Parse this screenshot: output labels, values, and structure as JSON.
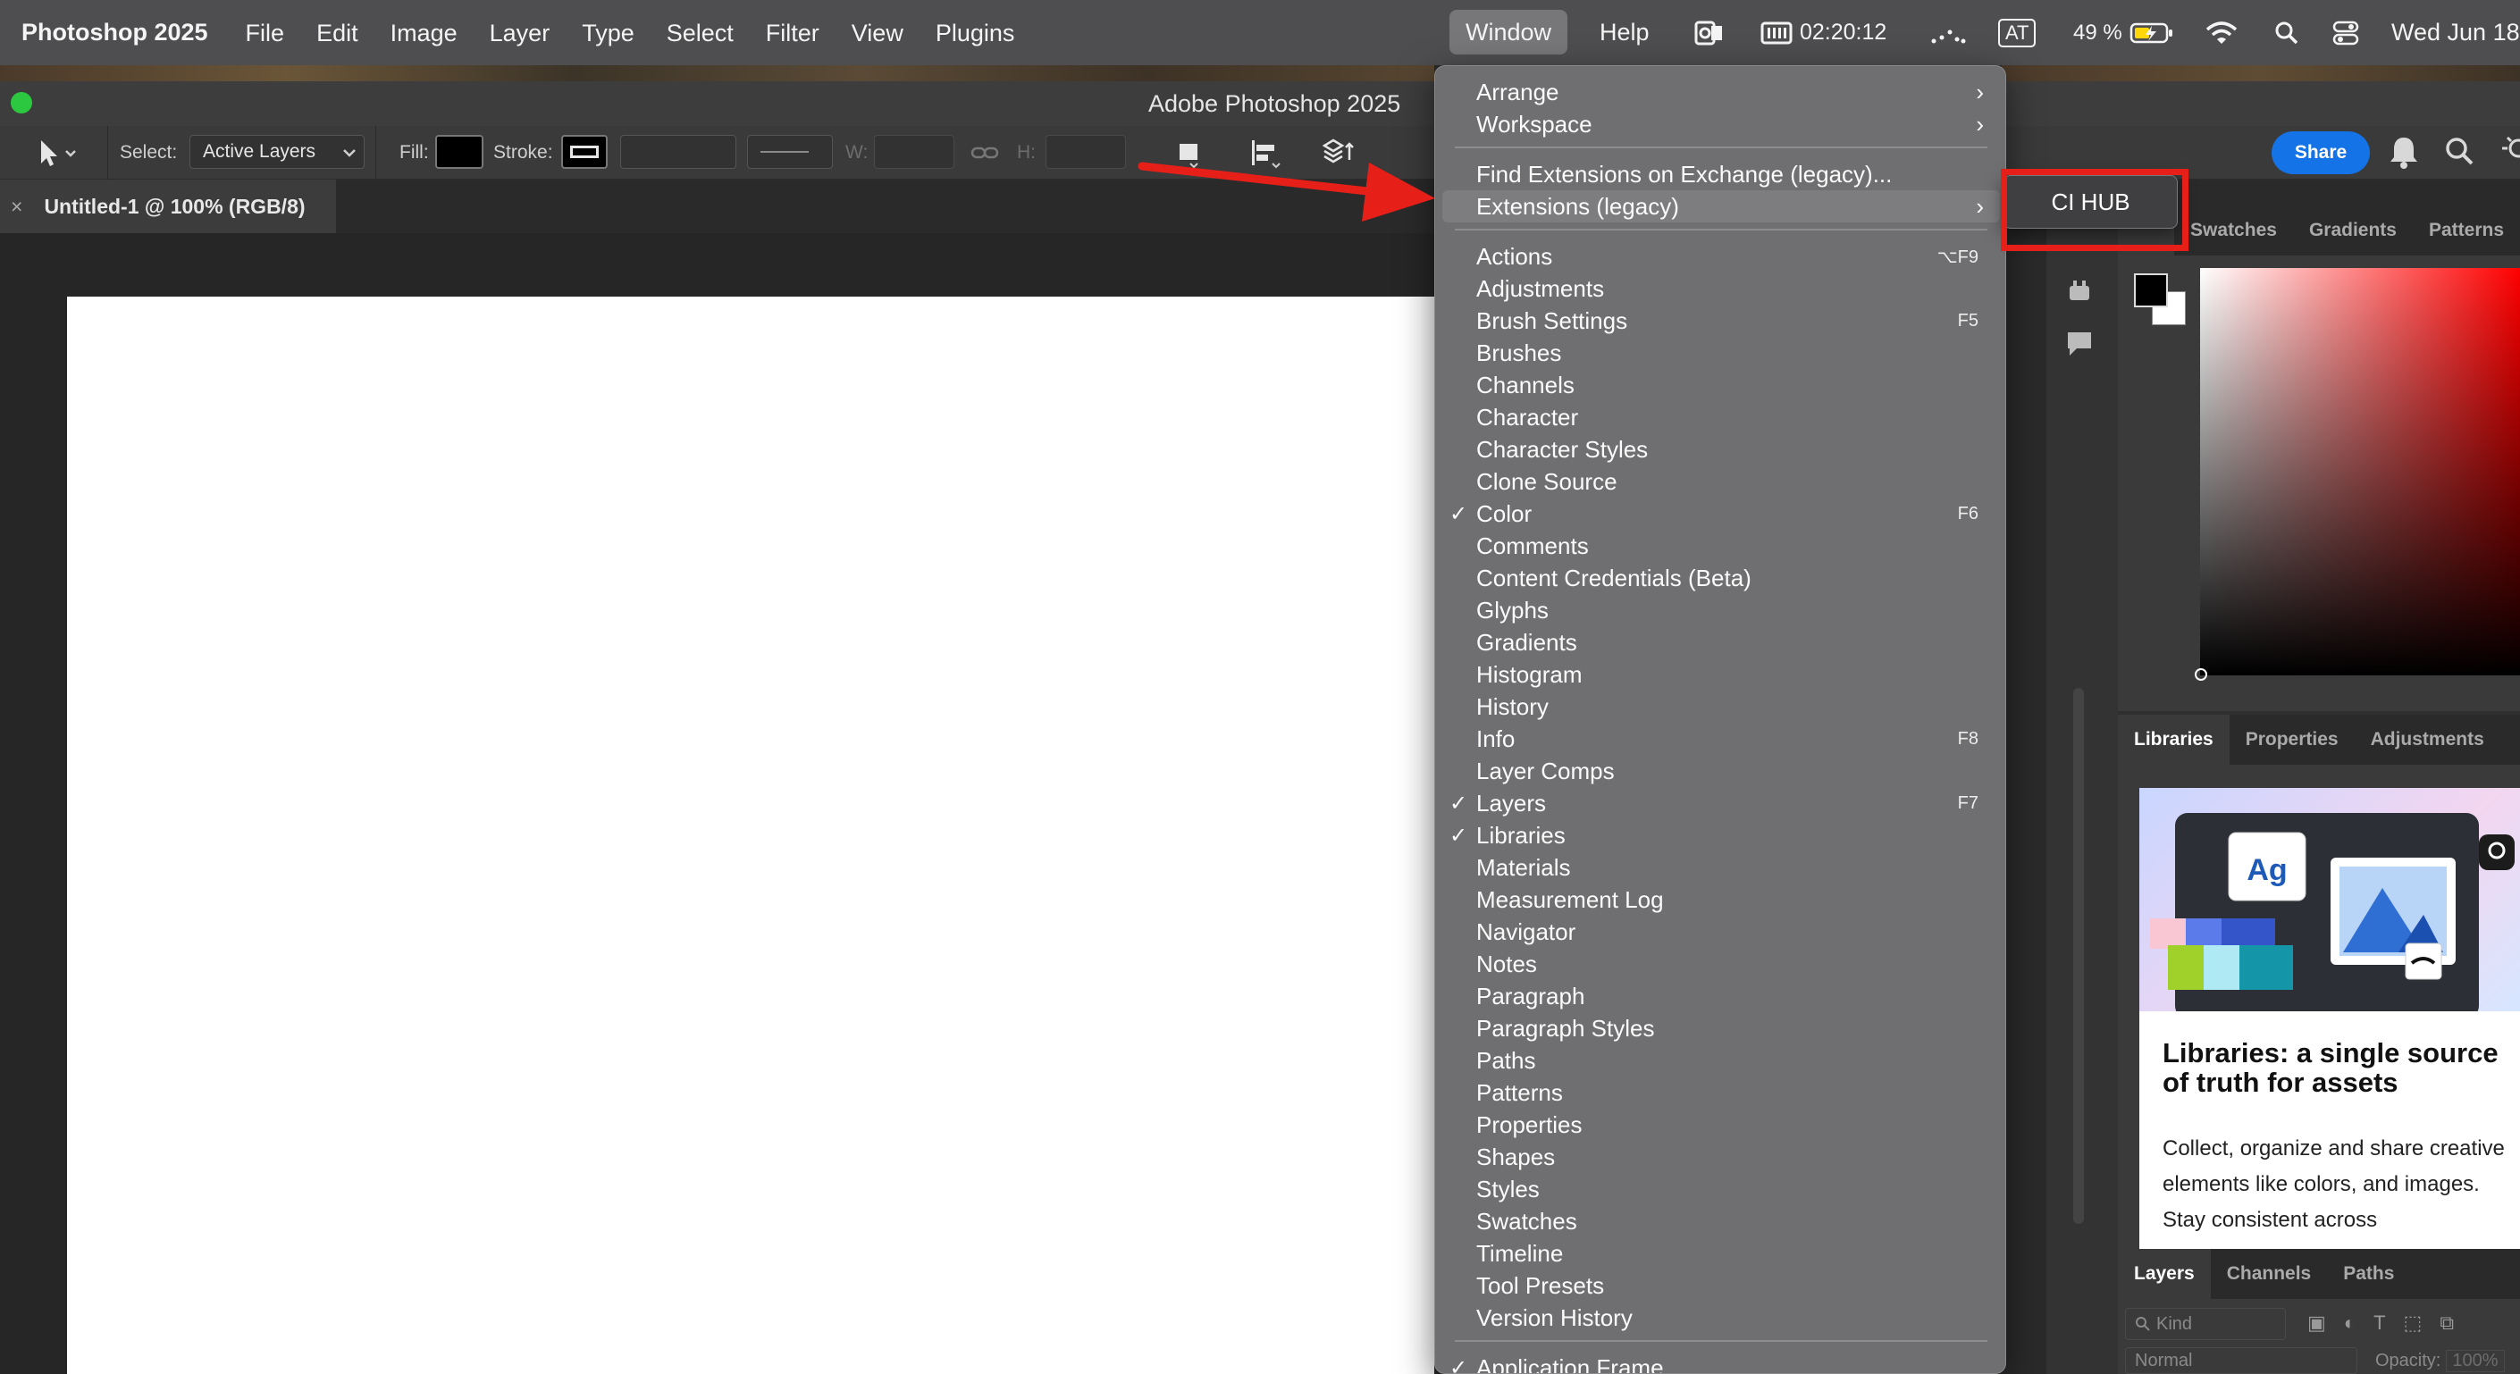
{
  "menubar": {
    "app_name": "Photoshop 2025",
    "items": [
      "File",
      "Edit",
      "Image",
      "Layer",
      "Type",
      "Select",
      "Filter",
      "View",
      "Plugins"
    ],
    "window": "Window",
    "help": "Help",
    "clock": "02:20:12",
    "input_source": "AT",
    "battery": "49 %",
    "date": "Wed Jun 18"
  },
  "window_title": "Adobe Photoshop 2025",
  "options": {
    "select_label": "Select:",
    "select_value": "Active Layers",
    "fill_label": "Fill:",
    "stroke_label": "Stroke:",
    "w_label": "W:",
    "h_label": "H:",
    "share": "Share"
  },
  "document": {
    "tab_title": "Untitled-1 @ 100% (RGB/8)",
    "close": "×"
  },
  "window_menu": {
    "top": [
      {
        "label": "Arrange",
        "submenu": true
      },
      {
        "label": "Workspace",
        "submenu": true
      }
    ],
    "extensions": [
      {
        "label": "Find Extensions on Exchange (legacy)...",
        "submenu": false
      },
      {
        "label": "Extensions (legacy)",
        "submenu": true,
        "highlighted": true
      }
    ],
    "panels": [
      {
        "label": "Actions",
        "shortcut": "⌥F9"
      },
      {
        "label": "Adjustments"
      },
      {
        "label": "Brush Settings",
        "shortcut": "F5"
      },
      {
        "label": "Brushes"
      },
      {
        "label": "Channels"
      },
      {
        "label": "Character"
      },
      {
        "label": "Character Styles"
      },
      {
        "label": "Clone Source"
      },
      {
        "label": "Color",
        "shortcut": "F6",
        "checked": true
      },
      {
        "label": "Comments"
      },
      {
        "label": "Content Credentials (Beta)"
      },
      {
        "label": "Glyphs"
      },
      {
        "label": "Gradients"
      },
      {
        "label": "Histogram"
      },
      {
        "label": "History"
      },
      {
        "label": "Info",
        "shortcut": "F8"
      },
      {
        "label": "Layer Comps"
      },
      {
        "label": "Layers",
        "shortcut": "F7",
        "checked": true
      },
      {
        "label": "Libraries",
        "checked": true
      },
      {
        "label": "Materials"
      },
      {
        "label": "Measurement Log"
      },
      {
        "label": "Navigator"
      },
      {
        "label": "Notes"
      },
      {
        "label": "Paragraph"
      },
      {
        "label": "Paragraph Styles"
      },
      {
        "label": "Paths"
      },
      {
        "label": "Patterns"
      },
      {
        "label": "Properties"
      },
      {
        "label": "Shapes"
      },
      {
        "label": "Styles"
      },
      {
        "label": "Swatches"
      },
      {
        "label": "Timeline"
      },
      {
        "label": "Tool Presets"
      },
      {
        "label": "Version History"
      }
    ],
    "bottom": [
      {
        "label": "Application Frame",
        "checked": true
      }
    ]
  },
  "submenu": {
    "item": "CI HUB"
  },
  "panels": {
    "color_tabs": [
      "Swatches",
      "Gradients",
      "Patterns"
    ],
    "library_tabs": [
      "Libraries",
      "Properties",
      "Adjustments"
    ],
    "layer_tabs": [
      "Layers",
      "Channels",
      "Paths"
    ],
    "library_card": {
      "heading": "Libraries: a single source of truth for assets",
      "body": "Collect, organize and share creative elements like colors, and images. Stay consistent across",
      "tile_text": "Ag"
    },
    "layers": {
      "kind": "Kind",
      "blend": "Normal",
      "opacity_label": "Opacity:",
      "opacity_value": "100%"
    }
  },
  "colors": {
    "menubar_bg": "#4e4e50",
    "menu_bg": "#6f6f71",
    "share_blue": "#1473e6",
    "annotation_red": "#e62019",
    "traffic_green": "#2bc840"
  }
}
